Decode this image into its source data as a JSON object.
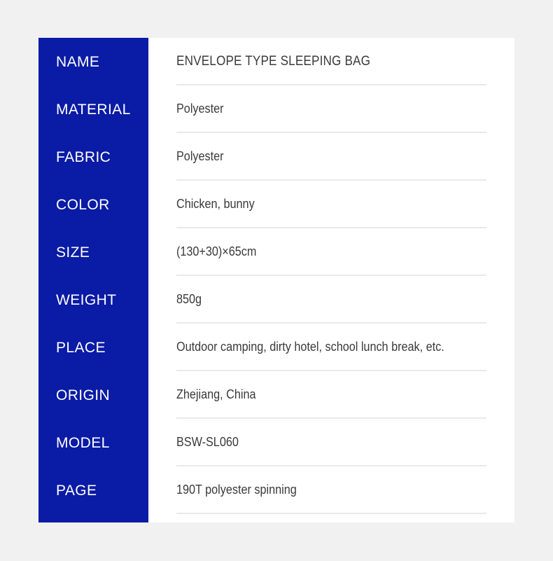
{
  "card": {
    "accent_color": "#0a1ba5",
    "background_color": "#ffffff",
    "page_background_color": "#f1f1f1",
    "divider_color": "#e9e9e9",
    "value_text_color": "#3a3a3a",
    "label_text_color": "#ffffff"
  },
  "spec_rows": [
    {
      "label": "NAME",
      "value": "ENVELOPE TYPE SLEEPING BAG"
    },
    {
      "label": "MATERIAL",
      "value": "Polyester"
    },
    {
      "label": "FABRIC",
      "value": "Polyester"
    },
    {
      "label": "COLOR",
      "value": "Chicken, bunny"
    },
    {
      "label": "SIZE",
      "value": "(130+30)×65cm"
    },
    {
      "label": "WEIGHT",
      "value": "850g"
    },
    {
      "label": "PLACE",
      "value": "Outdoor camping, dirty hotel, school lunch break, etc."
    },
    {
      "label": "ORIGIN",
      "value": "Zhejiang, China"
    },
    {
      "label": "MODEL",
      "value": "BSW-SL060"
    },
    {
      "label": "PAGE",
      "value": "190T polyester spinning"
    }
  ]
}
